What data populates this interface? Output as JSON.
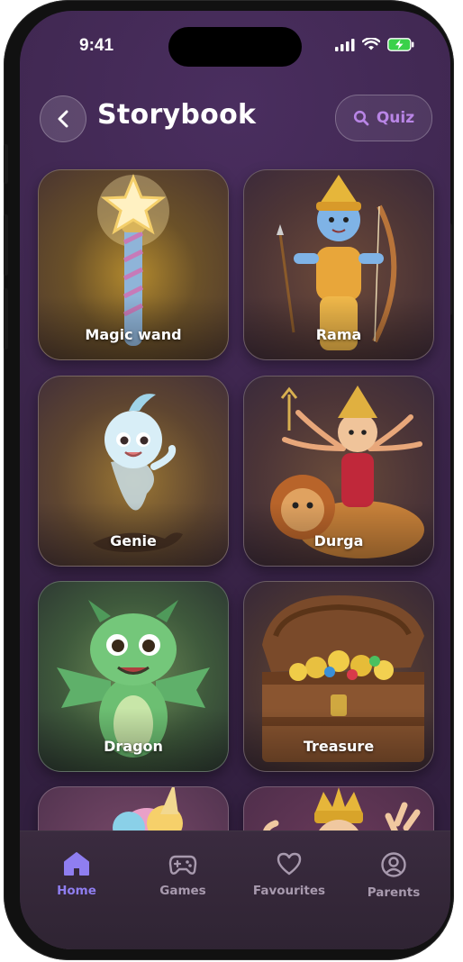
{
  "status_bar": {
    "time": "9:41"
  },
  "header": {
    "title": "Storybook",
    "quiz_label": "Quiz"
  },
  "cards": [
    {
      "label": "Magic wand"
    },
    {
      "label": "Rama"
    },
    {
      "label": "Genie"
    },
    {
      "label": "Durga"
    },
    {
      "label": "Dragon"
    },
    {
      "label": "Treasure"
    },
    {
      "label": ""
    },
    {
      "label": ""
    }
  ],
  "tabbar": {
    "tabs": [
      {
        "label": "Home",
        "icon": "home-icon",
        "active": true
      },
      {
        "label": "Games",
        "icon": "gamepad-icon",
        "active": false
      },
      {
        "label": "Favourites",
        "icon": "heart-icon",
        "active": false
      },
      {
        "label": "Parents",
        "icon": "user-circle-icon",
        "active": false
      }
    ]
  },
  "colors": {
    "accent": "#8f7ef0",
    "quiz": "#b985e6",
    "background": "#3a2449"
  }
}
